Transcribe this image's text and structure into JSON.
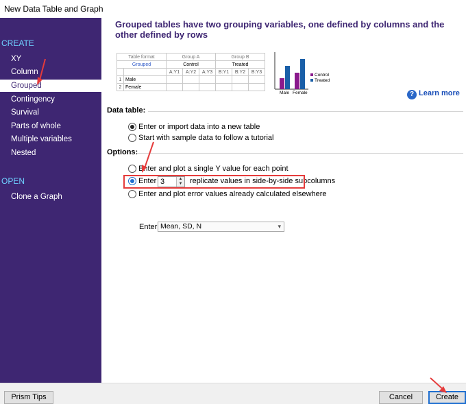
{
  "window": {
    "title": "New Data Table and Graph"
  },
  "sidebar": {
    "create_heading": "CREATE",
    "items": [
      {
        "label": "XY",
        "selected": false
      },
      {
        "label": "Column",
        "selected": false
      },
      {
        "label": "Grouped",
        "selected": true
      },
      {
        "label": "Contingency",
        "selected": false
      },
      {
        "label": "Survival",
        "selected": false
      },
      {
        "label": "Parts of whole",
        "selected": false
      },
      {
        "label": "Multiple variables",
        "selected": false
      },
      {
        "label": "Nested",
        "selected": false
      }
    ],
    "open_heading": "OPEN",
    "open_items": [
      {
        "label": "Clone a Graph"
      }
    ]
  },
  "main": {
    "heading": "Grouped tables have two grouping variables, one defined by columns and the other defined by rows",
    "preview": {
      "format_label": "Table format",
      "format_value": "Grouped",
      "group_a": "Group A",
      "group_b": "Group B",
      "sub_a": "Control",
      "sub_b": "Treated",
      "columns": [
        "A:Y1",
        "A:Y2",
        "A:Y3",
        "B:Y1",
        "B:Y2",
        "B:Y3"
      ],
      "rows": [
        {
          "num": "1",
          "label": "Male"
        },
        {
          "num": "2",
          "label": "Female"
        }
      ]
    },
    "mini_chart": {
      "legend": [
        "Control",
        "Treated"
      ],
      "categories": [
        "Male",
        "Female"
      ],
      "colors": {
        "control": "#8a1a8c",
        "treated": "#1a5fa8"
      }
    },
    "learn_more": "Learn more",
    "data_table": {
      "label": "Data table:",
      "options": [
        {
          "label": "Enter or import data into a new table",
          "selected": true
        },
        {
          "label": "Start with sample data to follow a tutorial",
          "selected": false
        }
      ]
    },
    "options": {
      "label": "Options:",
      "single_y": "Enter and plot a single Y value for each point",
      "replicates_prefix": "Enter",
      "replicates_value": "3",
      "replicates_suffix": "replicate values in side-by-side subcolumns",
      "error_values": "Enter and plot error values already calculated elsewhere",
      "enter_label": "Enter:",
      "enter_select": "Mean, SD, N"
    }
  },
  "footer": {
    "prism_tips": "Prism Tips",
    "cancel": "Cancel",
    "create": "Create"
  }
}
